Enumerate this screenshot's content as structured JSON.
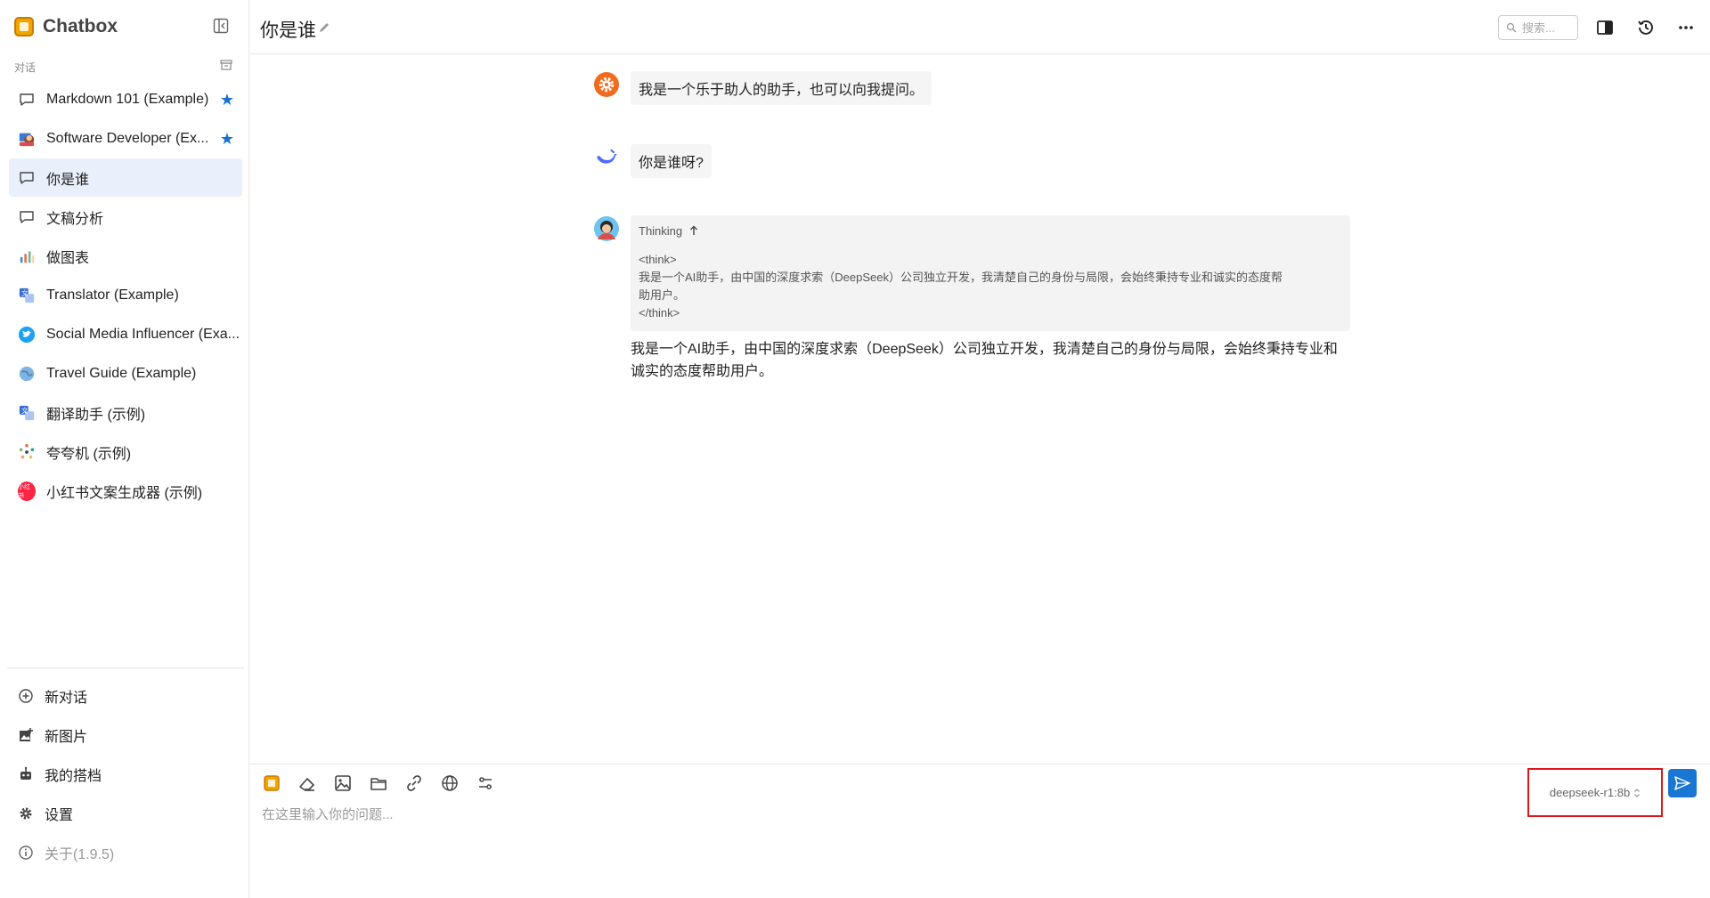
{
  "app": {
    "name": "Chatbox"
  },
  "sidebar": {
    "section_label": "对话",
    "conversations": [
      {
        "label": "Markdown 101 (Example)",
        "starred": true,
        "icon": "chat-bubble-icon"
      },
      {
        "label": "Software Developer (Ex...",
        "starred": true,
        "icon": "developer-avatar"
      },
      {
        "label": "你是谁",
        "starred": false,
        "icon": "chat-bubble-icon",
        "active": true
      },
      {
        "label": "文稿分析",
        "starred": false,
        "icon": "chat-bubble-icon"
      },
      {
        "label": "做图表",
        "starred": false,
        "icon": "chart-avatar"
      },
      {
        "label": "Translator (Example)",
        "starred": false,
        "icon": "translator-avatar"
      },
      {
        "label": "Social Media Influencer (Exa...",
        "starred": false,
        "icon": "twitter-avatar"
      },
      {
        "label": "Travel Guide (Example)",
        "starred": false,
        "icon": "globe-avatar"
      },
      {
        "label": "翻译助手 (示例)",
        "starred": false,
        "icon": "translator-avatar"
      },
      {
        "label": "夸夸机 (示例)",
        "starred": false,
        "icon": "sparkle-avatar"
      },
      {
        "label": "小红书文案生成器 (示例)",
        "starred": false,
        "icon": "xiaohongshu-avatar",
        "badge": "小红书"
      }
    ],
    "bottom_nav": {
      "new_chat": "新对话",
      "new_image": "新图片",
      "my_partners": "我的搭档",
      "settings": "设置",
      "about": "关于(1.9.5)"
    }
  },
  "header": {
    "title": "你是谁",
    "search_placeholder": "搜索..."
  },
  "messages": {
    "system": "我是一个乐于助人的助手，也可以向我提问。",
    "user": "你是谁呀?",
    "assistant": {
      "thinking_label": "Thinking",
      "thinking_lines": [
        "<think>",
        "我是一个AI助手，由中国的深度求索（DeepSeek）公司独立开发，我清楚自己的身份与局限，会始终秉持专业和诚实的态度帮",
        "助用户。",
        "</think>"
      ],
      "answer_lines": [
        "我是一个AI助手，由中国的深度求索（DeepSeek）公司独立开发，我清楚自己的身份与局限，会始终秉持专业和",
        "诚实的态度帮助用户。"
      ]
    }
  },
  "input": {
    "placeholder": "在这里输入你的问题...",
    "model": "deepseek-r1:8b"
  },
  "colors": {
    "accent": "#1976d2",
    "highlight_border": "#e0151c",
    "active_item": "#eaf0fb"
  }
}
